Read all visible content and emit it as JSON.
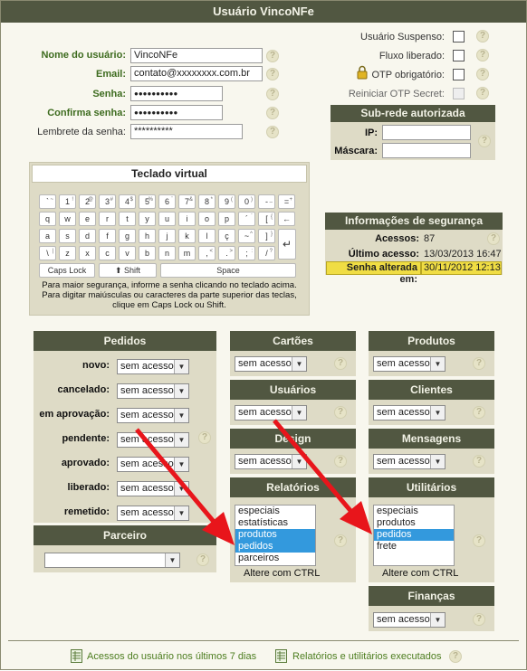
{
  "title": "Usuário VincoNFe",
  "form": {
    "nome_label": "Nome do usuário:",
    "nome_value": "VincoNFe",
    "email_label": "Email:",
    "email_value": "contato@xxxxxxxx.com.br",
    "senha_label": "Senha:",
    "senha_value": "●●●●●●●●●●",
    "confirma_label": "Confirma senha:",
    "confirma_value": "●●●●●●●●●●",
    "lembrete_label": "Lembrete da senha:",
    "lembrete_value": "**********"
  },
  "options": {
    "suspenso_label": "Usuário Suspenso:",
    "fluxo_label": "Fluxo liberado:",
    "otp_label": "OTP obrigatório:",
    "reiniciar_label": "Reiniciar OTP Secret:"
  },
  "subrede": {
    "title": "Sub-rede autorizada",
    "ip_label": "IP:",
    "mascara_label": "Máscara:"
  },
  "keyboard": {
    "title": "Teclado virtual",
    "row1": [
      [
        "`",
        "~"
      ],
      [
        "1",
        "!"
      ],
      [
        "2",
        "@"
      ],
      [
        "3",
        "#"
      ],
      [
        "4",
        "$"
      ],
      [
        "5",
        "%"
      ],
      [
        "6",
        "¨"
      ],
      [
        "7",
        "&"
      ],
      [
        "8",
        "*"
      ],
      [
        "9",
        "("
      ],
      [
        "0",
        ")"
      ],
      [
        "-",
        "_"
      ],
      [
        "=",
        "+"
      ]
    ],
    "row2": [
      [
        "q",
        ""
      ],
      [
        "w",
        ""
      ],
      [
        "e",
        ""
      ],
      [
        "r",
        ""
      ],
      [
        "t",
        ""
      ],
      [
        "y",
        ""
      ],
      [
        "u",
        ""
      ],
      [
        "i",
        ""
      ],
      [
        "o",
        ""
      ],
      [
        "p",
        ""
      ],
      [
        "´",
        "`"
      ],
      [
        "[",
        "{"
      ],
      [
        "←",
        ""
      ]
    ],
    "row3": [
      [
        "a",
        ""
      ],
      [
        "s",
        ""
      ],
      [
        "d",
        ""
      ],
      [
        "f",
        ""
      ],
      [
        "g",
        ""
      ],
      [
        "h",
        ""
      ],
      [
        "j",
        ""
      ],
      [
        "k",
        ""
      ],
      [
        "l",
        ""
      ],
      [
        "ç",
        ""
      ],
      [
        "~",
        "^"
      ],
      [
        "]",
        "}"
      ]
    ],
    "row4": [
      [
        "\\",
        "|"
      ],
      [
        "z",
        ""
      ],
      [
        "x",
        ""
      ],
      [
        "c",
        ""
      ],
      [
        "v",
        ""
      ],
      [
        "b",
        ""
      ],
      [
        "n",
        ""
      ],
      [
        "m",
        ""
      ],
      [
        ",",
        "<"
      ],
      [
        ".",
        ">"
      ],
      [
        ";",
        ":"
      ],
      [
        "/",
        "?"
      ]
    ],
    "enter": "↵",
    "caps": "Caps Lock",
    "shift": "⬆ Shift",
    "space": "Space",
    "note": "Para maior segurança, informe a senha clicando no teclado acima. Para digitar maiúsculas ou caracteres da parte superior das teclas, clique em Caps Lock ou Shift."
  },
  "seguranca": {
    "title": "Informações de segurança",
    "acessos_label": "Acessos:",
    "acessos_value": "87",
    "ultimo_label": "Último acesso:",
    "ultimo_value": "13/03/2013 16:47",
    "alterada_label": "Senha alterada em:",
    "alterada_value": "30/11/2012 12:13"
  },
  "pedidos": {
    "title": "Pedidos",
    "rows": [
      {
        "label": "novo:",
        "value": "sem acesso"
      },
      {
        "label": "cancelado:",
        "value": "sem acesso"
      },
      {
        "label": "em aprovação:",
        "value": "sem acesso"
      },
      {
        "label": "pendente:",
        "value": "sem acesso"
      },
      {
        "label": "aprovado:",
        "value": "sem acesso"
      },
      {
        "label": "liberado:",
        "value": "sem acesso"
      },
      {
        "label": "remetido:",
        "value": "sem acesso"
      }
    ]
  },
  "parceiro": {
    "title": "Parceiro",
    "value": ""
  },
  "cartoes": {
    "title": "Cartões",
    "value": "sem acesso"
  },
  "usuarios": {
    "title": "Usuários",
    "value": "sem acesso"
  },
  "design": {
    "title": "Design",
    "value": "sem acesso"
  },
  "relatorios": {
    "title": "Relatórios",
    "items": [
      "especiais",
      "estatísticas",
      "produtos",
      "pedidos",
      "parceiros"
    ],
    "note": "Altere com CTRL"
  },
  "produtos": {
    "title": "Produtos",
    "value": "sem acesso"
  },
  "clientes": {
    "title": "Clientes",
    "value": "sem acesso"
  },
  "mensagens": {
    "title": "Mensagens",
    "value": "sem acesso"
  },
  "utilitarios": {
    "title": "Utilitários",
    "items": [
      "especiais",
      "produtos",
      "pedidos",
      "frete"
    ],
    "note": "Altere com CTRL"
  },
  "financas": {
    "title": "Finanças",
    "value": "sem acesso"
  },
  "footer": {
    "acessos_link": "Acessos do usuário nos últimos 7 dias",
    "relatorios_link": "Relatórios e utilitários executados"
  },
  "help_glyph": "?",
  "colors": {
    "header": "#515741",
    "panel": "#dedbc6",
    "accent_green": "#3d6b1e",
    "highlight": "#f0dd44",
    "arrow": "#e8151b",
    "select": "#3399dd"
  }
}
